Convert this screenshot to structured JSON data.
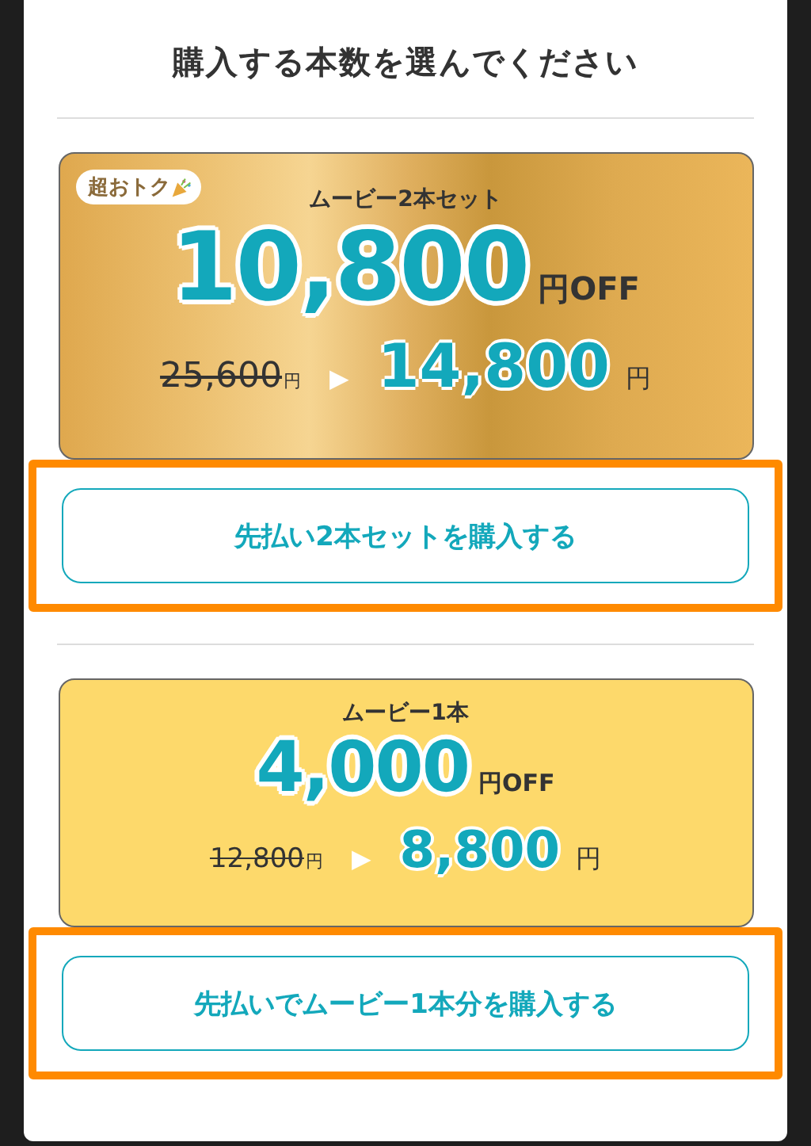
{
  "title": "購入する本数を選んでください",
  "plans": [
    {
      "kind": "gold",
      "badge": "超おトク",
      "name": "ムービー2本セット",
      "discount": "10,800",
      "discount_unit": "円",
      "off": "OFF",
      "original_price": "25,600",
      "original_unit": "円",
      "arrow": "▶",
      "price": "14,800",
      "price_unit": "円",
      "button": "先払い2本セットを購入する",
      "highlighted": true
    },
    {
      "kind": "yellow",
      "name": "ムービー1本",
      "discount": "4,000",
      "discount_unit": "円",
      "off": "OFF",
      "original_price": "12,800",
      "original_unit": "円",
      "arrow": "▶",
      "price": "8,800",
      "price_unit": "円",
      "button": "先払いでムービー1本分を購入する",
      "highlighted": true
    }
  ]
}
